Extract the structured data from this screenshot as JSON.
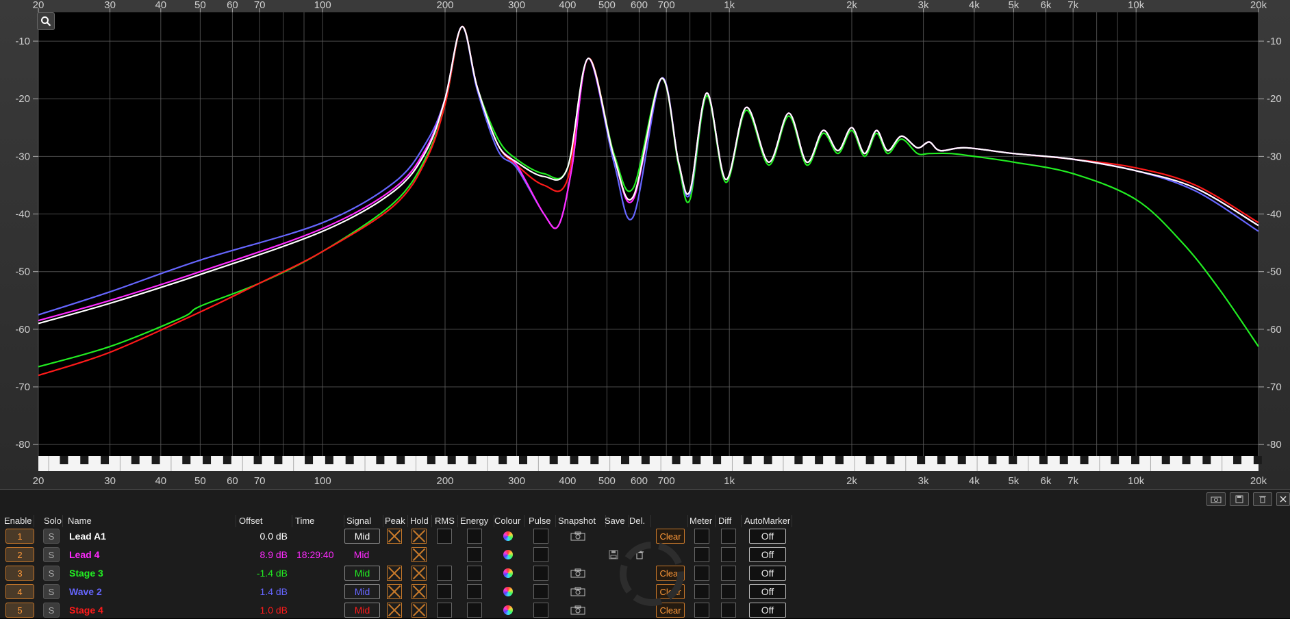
{
  "x_axis": {
    "tick_labels": [
      {
        "label": "20",
        "hz": 20
      },
      {
        "label": "30",
        "hz": 30
      },
      {
        "label": "40",
        "hz": 40
      },
      {
        "label": "50",
        "hz": 50
      },
      {
        "label": "60",
        "hz": 60
      },
      {
        "label": "70",
        "hz": 70
      },
      {
        "label": "100",
        "hz": 100
      },
      {
        "label": "200",
        "hz": 200
      },
      {
        "label": "300",
        "hz": 300
      },
      {
        "label": "400",
        "hz": 400
      },
      {
        "label": "500",
        "hz": 500
      },
      {
        "label": "600",
        "hz": 600
      },
      {
        "label": "700",
        "hz": 700
      },
      {
        "label": "1k",
        "hz": 1000
      },
      {
        "label": "2k",
        "hz": 2000
      },
      {
        "label": "3k",
        "hz": 3000
      },
      {
        "label": "4k",
        "hz": 4000
      },
      {
        "label": "5k",
        "hz": 5000
      },
      {
        "label": "6k",
        "hz": 6000
      },
      {
        "label": "7k",
        "hz": 7000
      },
      {
        "label": "10k",
        "hz": 10000
      },
      {
        "label": "20k",
        "hz": 20000
      }
    ],
    "range_hz": [
      20,
      20000
    ],
    "scale": "log"
  },
  "y_axis": {
    "tick_labels": [
      "-10",
      "-20",
      "-30",
      "-40",
      "-50",
      "-60",
      "-70",
      "-80"
    ],
    "range_db": [
      -82,
      -5
    ]
  },
  "chart_data": {
    "type": "line",
    "series": [
      {
        "name": "Lead A1",
        "color": "#ffffff",
        "points": [
          [
            20,
            -59
          ],
          [
            30,
            -55.5
          ],
          [
            50,
            -50.5
          ],
          [
            100,
            -43
          ],
          [
            150,
            -36
          ],
          [
            180,
            -29
          ],
          [
            200,
            -20
          ],
          [
            220,
            -7.5
          ],
          [
            240,
            -18
          ],
          [
            270,
            -28
          ],
          [
            300,
            -31
          ],
          [
            350,
            -33.5
          ],
          [
            400,
            -32
          ],
          [
            450,
            -13
          ],
          [
            520,
            -30
          ],
          [
            580,
            -37
          ],
          [
            680,
            -16.5
          ],
          [
            750,
            -31
          ],
          [
            800,
            -36
          ],
          [
            880,
            -19
          ],
          [
            980,
            -34
          ],
          [
            1100,
            -21.5
          ],
          [
            1250,
            -31
          ],
          [
            1400,
            -22.5
          ],
          [
            1550,
            -31
          ],
          [
            1700,
            -25.5
          ],
          [
            1850,
            -29
          ],
          [
            2000,
            -25
          ],
          [
            2150,
            -29.5
          ],
          [
            2300,
            -25.5
          ],
          [
            2450,
            -29
          ],
          [
            2650,
            -26.5
          ],
          [
            2900,
            -28.5
          ],
          [
            3100,
            -27.5
          ],
          [
            3300,
            -29
          ],
          [
            3800,
            -28.5
          ],
          [
            5000,
            -29.5
          ],
          [
            7000,
            -30.5
          ],
          [
            10000,
            -32.5
          ],
          [
            14000,
            -35.5
          ],
          [
            20000,
            -42
          ]
        ]
      },
      {
        "name": "Lead 4",
        "color": "#ff2aff",
        "points": [
          [
            20,
            -58.5
          ],
          [
            30,
            -55
          ],
          [
            50,
            -50
          ],
          [
            100,
            -42.5
          ],
          [
            150,
            -35.5
          ],
          [
            180,
            -28.5
          ],
          [
            200,
            -20
          ],
          [
            220,
            -7.5
          ],
          [
            240,
            -18
          ],
          [
            270,
            -28
          ],
          [
            300,
            -31.5
          ],
          [
            350,
            -40
          ],
          [
            380,
            -42
          ],
          [
            410,
            -32
          ],
          [
            450,
            -13
          ],
          [
            520,
            -30
          ],
          [
            580,
            -37.5
          ],
          [
            680,
            -16.5
          ],
          [
            750,
            -31
          ],
          [
            800,
            -36
          ],
          [
            880,
            -19
          ],
          [
            980,
            -34
          ],
          [
            1100,
            -21.5
          ],
          [
            1250,
            -31
          ],
          [
            1400,
            -22.5
          ],
          [
            1550,
            -31
          ],
          [
            1700,
            -25.5
          ],
          [
            1850,
            -29
          ],
          [
            2000,
            -25
          ],
          [
            2150,
            -29.5
          ],
          [
            2300,
            -25.5
          ],
          [
            2450,
            -29
          ],
          [
            2650,
            -26.5
          ],
          [
            2900,
            -28.5
          ],
          [
            3100,
            -27.5
          ],
          [
            3300,
            -29
          ],
          [
            3800,
            -28.5
          ],
          [
            5000,
            -29.5
          ],
          [
            7000,
            -30.5
          ],
          [
            10000,
            -32.5
          ],
          [
            14000,
            -35.5
          ],
          [
            20000,
            -42
          ]
        ]
      },
      {
        "name": "Stage 3",
        "color": "#22ee22",
        "points": [
          [
            20,
            -66.5
          ],
          [
            30,
            -63
          ],
          [
            45,
            -58
          ],
          [
            50,
            -56
          ],
          [
            70,
            -52
          ],
          [
            100,
            -46.5
          ],
          [
            150,
            -38
          ],
          [
            180,
            -30
          ],
          [
            200,
            -21
          ],
          [
            220,
            -7.5
          ],
          [
            240,
            -18
          ],
          [
            270,
            -27
          ],
          [
            300,
            -30.5
          ],
          [
            350,
            -33
          ],
          [
            400,
            -32
          ],
          [
            450,
            -13
          ],
          [
            520,
            -29.5
          ],
          [
            580,
            -35.5
          ],
          [
            680,
            -16.5
          ],
          [
            750,
            -31.5
          ],
          [
            800,
            -37.5
          ],
          [
            880,
            -19.5
          ],
          [
            980,
            -34.5
          ],
          [
            1100,
            -22
          ],
          [
            1250,
            -31.5
          ],
          [
            1400,
            -23
          ],
          [
            1550,
            -31.5
          ],
          [
            1700,
            -26
          ],
          [
            1850,
            -29.5
          ],
          [
            2000,
            -25.5
          ],
          [
            2150,
            -30
          ],
          [
            2300,
            -26
          ],
          [
            2450,
            -29.5
          ],
          [
            2650,
            -27
          ],
          [
            2900,
            -29.5
          ],
          [
            3100,
            -29.5
          ],
          [
            3500,
            -29.5
          ],
          [
            4000,
            -30
          ],
          [
            5000,
            -31
          ],
          [
            7000,
            -33
          ],
          [
            10000,
            -37.5
          ],
          [
            13000,
            -45
          ],
          [
            16000,
            -53
          ],
          [
            20000,
            -63
          ]
        ]
      },
      {
        "name": "Wave 2",
        "color": "#6666ff",
        "points": [
          [
            20,
            -57.5
          ],
          [
            30,
            -53.5
          ],
          [
            50,
            -48
          ],
          [
            100,
            -41.5
          ],
          [
            150,
            -34.5
          ],
          [
            180,
            -27.5
          ],
          [
            200,
            -20
          ],
          [
            220,
            -7.5
          ],
          [
            240,
            -18.5
          ],
          [
            270,
            -29
          ],
          [
            300,
            -32
          ],
          [
            350,
            -40
          ],
          [
            380,
            -42
          ],
          [
            410,
            -32
          ],
          [
            450,
            -13
          ],
          [
            520,
            -31
          ],
          [
            580,
            -40.5
          ],
          [
            680,
            -16.5
          ],
          [
            750,
            -31
          ],
          [
            800,
            -36.5
          ],
          [
            880,
            -19
          ],
          [
            980,
            -34
          ],
          [
            1100,
            -21.5
          ],
          [
            1250,
            -31
          ],
          [
            1400,
            -22.5
          ],
          [
            1550,
            -31
          ],
          [
            1700,
            -25.5
          ],
          [
            1850,
            -29
          ],
          [
            2000,
            -25
          ],
          [
            2150,
            -29.5
          ],
          [
            2300,
            -25.5
          ],
          [
            2450,
            -29
          ],
          [
            2650,
            -26.5
          ],
          [
            2900,
            -28.5
          ],
          [
            3100,
            -27.5
          ],
          [
            3300,
            -29
          ],
          [
            3800,
            -28.5
          ],
          [
            5000,
            -29.5
          ],
          [
            7000,
            -30.5
          ],
          [
            10000,
            -32.5
          ],
          [
            14000,
            -36
          ],
          [
            20000,
            -43
          ]
        ]
      },
      {
        "name": "Stage 4",
        "color": "#ff1a1a",
        "points": [
          [
            20,
            -68
          ],
          [
            30,
            -64
          ],
          [
            50,
            -57
          ],
          [
            70,
            -52
          ],
          [
            100,
            -46.5
          ],
          [
            150,
            -38.5
          ],
          [
            180,
            -30.5
          ],
          [
            200,
            -21
          ],
          [
            220,
            -7.5
          ],
          [
            240,
            -18
          ],
          [
            270,
            -28
          ],
          [
            300,
            -31.5
          ],
          [
            350,
            -35
          ],
          [
            400,
            -34
          ],
          [
            450,
            -13
          ],
          [
            520,
            -30
          ],
          [
            580,
            -37
          ],
          [
            680,
            -16.5
          ],
          [
            750,
            -31
          ],
          [
            800,
            -36
          ],
          [
            880,
            -19
          ],
          [
            980,
            -34
          ],
          [
            1100,
            -21.5
          ],
          [
            1250,
            -31
          ],
          [
            1400,
            -22.5
          ],
          [
            1550,
            -31
          ],
          [
            1700,
            -25.5
          ],
          [
            1850,
            -29
          ],
          [
            2000,
            -25
          ],
          [
            2150,
            -29.5
          ],
          [
            2300,
            -25.5
          ],
          [
            2450,
            -29
          ],
          [
            2650,
            -26.5
          ],
          [
            2900,
            -28.5
          ],
          [
            3100,
            -27.5
          ],
          [
            3300,
            -29
          ],
          [
            3800,
            -28.5
          ],
          [
            5000,
            -29.5
          ],
          [
            7000,
            -30.5
          ],
          [
            10000,
            -32
          ],
          [
            14000,
            -35
          ],
          [
            20000,
            -41.5
          ]
        ]
      }
    ]
  },
  "table": {
    "headers": {
      "enable": "Enable",
      "solo": "Solo",
      "name": "Name",
      "offset": "Offset",
      "time": "Time",
      "signal": "Signal",
      "peak": "Peak",
      "hold": "Hold",
      "rms": "RMS",
      "energy": "Energy",
      "colour": "Colour",
      "pulse": "Pulse",
      "snapshot": "Snapshot",
      "save": "Save",
      "del": "Del.",
      "meter": "Meter",
      "diff": "Diff",
      "automarker": "AutoMarker"
    },
    "rows": [
      {
        "index": "1",
        "solo": "S",
        "name": "Lead A1",
        "color": "#ffffff",
        "offset": "0.0 dB",
        "time": "",
        "signal": "Mid",
        "peak": true,
        "hold": true,
        "rms": false,
        "energy": false,
        "pulse": false,
        "snapshot": true,
        "clear": "Clear",
        "automarker": "Off"
      },
      {
        "index": "2",
        "solo": "S",
        "name": "Lead 4",
        "color": "#ff2aff",
        "offset": "8.9 dB",
        "time": "18:29:40",
        "signal": "Mid",
        "peak": null,
        "hold": true,
        "rms": null,
        "energy": false,
        "pulse": false,
        "snapshot": false,
        "clear": null,
        "automarker": "Off"
      },
      {
        "index": "3",
        "solo": "S",
        "name": "Stage 3",
        "color": "#22ee22",
        "offset": "-1.4 dB",
        "time": "",
        "signal": "Mid",
        "peak": true,
        "hold": true,
        "rms": false,
        "energy": false,
        "pulse": false,
        "snapshot": true,
        "clear": "Clear",
        "automarker": "Off"
      },
      {
        "index": "4",
        "solo": "S",
        "name": "Wave 2",
        "color": "#6666ff",
        "offset": "1.4 dB",
        "time": "",
        "signal": "Mid",
        "peak": true,
        "hold": true,
        "rms": false,
        "energy": false,
        "pulse": false,
        "snapshot": true,
        "clear": "Clear",
        "automarker": "Off"
      },
      {
        "index": "5",
        "solo": "S",
        "name": "Stage 4",
        "color": "#ff1a1a",
        "offset": "1.0 dB",
        "time": "",
        "signal": "Mid",
        "peak": true,
        "hold": true,
        "rms": false,
        "energy": false,
        "pulse": false,
        "snapshot": true,
        "clear": "Clear",
        "automarker": "Off"
      }
    ]
  },
  "icons": {
    "zoom": "magnifier-icon",
    "snapshot": "camera-icon",
    "save": "floppy-disk-icon",
    "delete": "trash-icon",
    "close": "close-icon"
  },
  "colors": {
    "accent": "#ff9a3a",
    "grid": "#5a5a5a",
    "plot_bg": "#000000"
  }
}
